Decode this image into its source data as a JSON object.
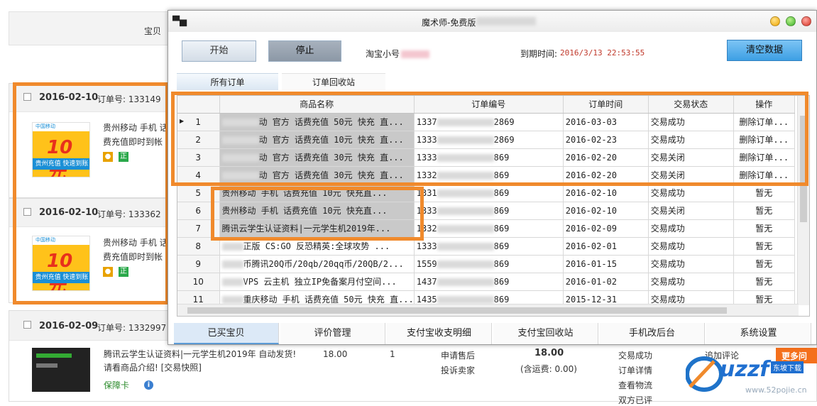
{
  "background": {
    "header_label": "宝贝",
    "orders": [
      {
        "date": "2016-02-10",
        "order_no": "订单号: 133149",
        "product": "贵州移动 手机 话费充值即时到帐",
        "badge1": "",
        "badge2": "正"
      },
      {
        "date": "2016-02-10",
        "order_no": "订单号: 133362",
        "product": "贵州移动 手机 话费充值即时到帐",
        "badge1": "",
        "badge2": "正"
      }
    ],
    "img_top": "中国移动",
    "img_price": "10元",
    "img_band": "贵州充值 快速到账",
    "row3": {
      "date": "2016-02-09",
      "order_no": "订单号: 1332997",
      "product": "腾讯云学生认证资料|一元学生机2019年 自动发货! 请看商品介绍! [交易快照]",
      "tag": "保障卡",
      "price": "18.00",
      "qty": "1",
      "service1": "申请售后",
      "service2": "投诉卖家",
      "total": "18.00",
      "total_note": "(含运费: 0.00)",
      "status1": "交易成功",
      "status2": "订单详情",
      "status3": "查看物流",
      "status4": "双方已评",
      "action": "追加评论",
      "more": "更多问"
    },
    "watermark_text": "uzzf",
    "watermark_sub": "东坡下载",
    "watermark_url": "www.52pojie.cn"
  },
  "window": {
    "title": "魔术师-免费版",
    "buttons": {
      "start": "开始",
      "stop": "停止",
      "clear": "清空数据"
    },
    "account_label": "淘宝小号",
    "expire_label": "到期时间:",
    "expire_value": "2016/3/13 22:53:55",
    "tabs": [
      "所有订单",
      "订单回收站"
    ],
    "columns": [
      "商品名称",
      "订单编号",
      "订单时间",
      "交易状态",
      "操作"
    ],
    "rows": [
      {
        "n": "1",
        "name": "动 官方 话费充值 50元 快充 直...",
        "no_pre": "1337",
        "no_suf": "2869",
        "time": "2016-03-03",
        "status": "交易成功",
        "op": "删除订单..."
      },
      {
        "n": "2",
        "name": "动 官方 话费充值 10元 快充 直...",
        "no_pre": "1333",
        "no_suf": "2869",
        "time": "2016-02-23",
        "status": "交易成功",
        "op": "删除订单..."
      },
      {
        "n": "3",
        "name": "动 官方 话费充值 30元 快充 直...",
        "no_pre": "1333",
        "no_suf": "869",
        "time": "2016-02-20",
        "status": "交易关闭",
        "op": "删除订单..."
      },
      {
        "n": "4",
        "name": "动 官方 话费充值 30元 快充 直...",
        "no_pre": "1332",
        "no_suf": "869",
        "time": "2016-02-20",
        "status": "交易关闭",
        "op": "删除订单..."
      },
      {
        "n": "5",
        "name": "贵州移动 手机 话费充值 10元 快充直...",
        "no_pre": "1331",
        "no_suf": "869",
        "time": "2016-02-10",
        "status": "交易成功",
        "op": "暂无"
      },
      {
        "n": "6",
        "name": "贵州移动 手机 话费充值 10元 快充直...",
        "no_pre": "1333",
        "no_suf": "869",
        "time": "2016-02-10",
        "status": "交易关闭",
        "op": "暂无"
      },
      {
        "n": "7",
        "name": "腾讯云学生认证资料|一元学生机2019年...",
        "no_pre": "1332",
        "no_suf": "869",
        "time": "2016-02-09",
        "status": "交易成功",
        "op": "暂无"
      },
      {
        "n": "8",
        "name": "正版 CS:GO 反恐精英:全球攻势 ...",
        "no_pre": "1333",
        "no_suf": "869",
        "time": "2016-02-01",
        "status": "交易成功",
        "op": "暂无"
      },
      {
        "n": "9",
        "name": "币腾讯20Q币/20qb/20qq币/20QB/2...",
        "no_pre": "1559",
        "no_suf": "869",
        "time": "2016-01-15",
        "status": "交易成功",
        "op": "暂无"
      },
      {
        "n": "10",
        "name": "VPS 云主机 独立IP免备案月付空间...",
        "no_pre": "1437",
        "no_suf": "869",
        "time": "2016-01-02",
        "status": "交易成功",
        "op": "暂无"
      },
      {
        "n": "11",
        "name": "重庆移动 手机 话费充值 50元 快充 直...",
        "no_pre": "1435",
        "no_suf": "869",
        "time": "2015-12-31",
        "status": "交易成功",
        "op": "暂无"
      }
    ],
    "bottom_tabs": [
      "已买宝贝",
      "评价管理",
      "支付宝收支明细",
      "支付宝回收站",
      "手机改后台",
      "系统设置"
    ]
  },
  "colors": {
    "highlight": "#f08a2c",
    "accent_btn": "#4aa7e8",
    "expire_red": "#c0392b"
  }
}
